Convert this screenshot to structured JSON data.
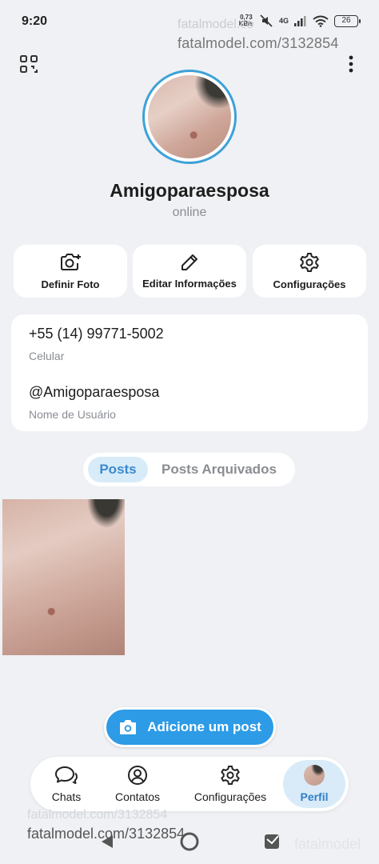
{
  "status_bar": {
    "time": "9:20",
    "net_speed_value": "0,73",
    "net_speed_unit": "KB/s",
    "network": "4G",
    "battery": "26"
  },
  "watermark": {
    "top": "fatalmodel.com/3132854",
    "top_faded": "fatalmodel.co",
    "bottom": "fatalmodel.com/3132854",
    "bottom_faded": "fatalmodel.com/3132854",
    "corner": "fatalmodel"
  },
  "header": {
    "qr_icon": "qr-code-icon",
    "menu_icon": "more-vertical-icon"
  },
  "profile": {
    "name": "Amigoparaesposa",
    "status": "online"
  },
  "actions": [
    {
      "label": "Definir Foto",
      "icon": "camera-add-icon"
    },
    {
      "label": "Editar Informações",
      "icon": "pencil-icon"
    },
    {
      "label": "Configurações",
      "icon": "gear-icon"
    }
  ],
  "info": {
    "phone": "+55 (14) 99771-5002",
    "phone_label": "Celular",
    "username": "@Amigoparaesposa",
    "username_label": "Nome de Usuário"
  },
  "tabs": {
    "active": "Posts",
    "inactive": "Posts Arquivados"
  },
  "add_post_label": "Adicione um post",
  "bottom_nav": [
    {
      "label": "Chats",
      "icon": "chat-bubbles-icon"
    },
    {
      "label": "Contatos",
      "icon": "user-circle-icon"
    },
    {
      "label": "Configurações",
      "icon": "gear-icon"
    },
    {
      "label": "Perfil",
      "icon": "avatar",
      "active": true
    }
  ],
  "colors": {
    "accent": "#2d9be6",
    "background": "#eff1f4",
    "active_tab_bg": "#d8ebf8"
  }
}
